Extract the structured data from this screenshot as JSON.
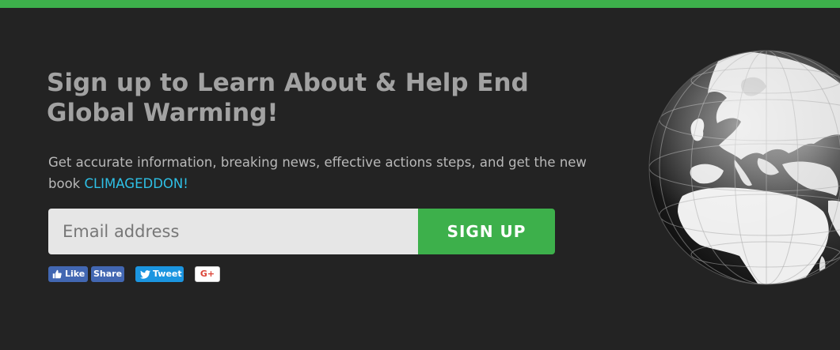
{
  "headline": "Sign up to Learn About & Help End Global Warming!",
  "description": {
    "text": "Get accurate information, breaking news, effective actions steps, and get the new book ",
    "highlight": "CLIMAGEDDON!"
  },
  "form": {
    "email_placeholder": "Email address",
    "signup_label": "SIGN UP"
  },
  "social": {
    "like_label": "Like",
    "share_label": "Share",
    "tweet_label": "Tweet",
    "gplus_label": "G+"
  },
  "colors": {
    "background": "#232323",
    "accent_green": "#3db04b",
    "highlight_cyan": "#2ec0e6",
    "headline_gray": "#a2a2a2",
    "facebook_blue": "#4267b2",
    "twitter_blue": "#1b95e0"
  },
  "icons": [
    "thumbs-up-icon",
    "twitter-bird-icon",
    "globe-icon"
  ]
}
